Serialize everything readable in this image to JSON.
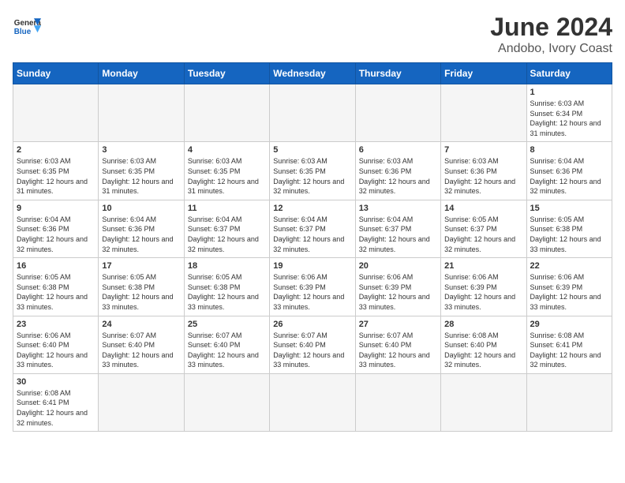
{
  "header": {
    "logo_general": "General",
    "logo_blue": "Blue",
    "title": "June 2024",
    "subtitle": "Andobo, Ivory Coast"
  },
  "weekdays": [
    "Sunday",
    "Monday",
    "Tuesday",
    "Wednesday",
    "Thursday",
    "Friday",
    "Saturday"
  ],
  "weeks": [
    [
      {
        "day": "",
        "info": ""
      },
      {
        "day": "",
        "info": ""
      },
      {
        "day": "",
        "info": ""
      },
      {
        "day": "",
        "info": ""
      },
      {
        "day": "",
        "info": ""
      },
      {
        "day": "",
        "info": ""
      },
      {
        "day": "1",
        "info": "Sunrise: 6:03 AM\nSunset: 6:34 PM\nDaylight: 12 hours and 31 minutes."
      }
    ],
    [
      {
        "day": "2",
        "info": "Sunrise: 6:03 AM\nSunset: 6:35 PM\nDaylight: 12 hours and 31 minutes."
      },
      {
        "day": "3",
        "info": "Sunrise: 6:03 AM\nSunset: 6:35 PM\nDaylight: 12 hours and 31 minutes."
      },
      {
        "day": "4",
        "info": "Sunrise: 6:03 AM\nSunset: 6:35 PM\nDaylight: 12 hours and 31 minutes."
      },
      {
        "day": "5",
        "info": "Sunrise: 6:03 AM\nSunset: 6:35 PM\nDaylight: 12 hours and 32 minutes."
      },
      {
        "day": "6",
        "info": "Sunrise: 6:03 AM\nSunset: 6:36 PM\nDaylight: 12 hours and 32 minutes."
      },
      {
        "day": "7",
        "info": "Sunrise: 6:03 AM\nSunset: 6:36 PM\nDaylight: 12 hours and 32 minutes."
      },
      {
        "day": "8",
        "info": "Sunrise: 6:04 AM\nSunset: 6:36 PM\nDaylight: 12 hours and 32 minutes."
      }
    ],
    [
      {
        "day": "9",
        "info": "Sunrise: 6:04 AM\nSunset: 6:36 PM\nDaylight: 12 hours and 32 minutes."
      },
      {
        "day": "10",
        "info": "Sunrise: 6:04 AM\nSunset: 6:36 PM\nDaylight: 12 hours and 32 minutes."
      },
      {
        "day": "11",
        "info": "Sunrise: 6:04 AM\nSunset: 6:37 PM\nDaylight: 12 hours and 32 minutes."
      },
      {
        "day": "12",
        "info": "Sunrise: 6:04 AM\nSunset: 6:37 PM\nDaylight: 12 hours and 32 minutes."
      },
      {
        "day": "13",
        "info": "Sunrise: 6:04 AM\nSunset: 6:37 PM\nDaylight: 12 hours and 32 minutes."
      },
      {
        "day": "14",
        "info": "Sunrise: 6:05 AM\nSunset: 6:37 PM\nDaylight: 12 hours and 32 minutes."
      },
      {
        "day": "15",
        "info": "Sunrise: 6:05 AM\nSunset: 6:38 PM\nDaylight: 12 hours and 33 minutes."
      }
    ],
    [
      {
        "day": "16",
        "info": "Sunrise: 6:05 AM\nSunset: 6:38 PM\nDaylight: 12 hours and 33 minutes."
      },
      {
        "day": "17",
        "info": "Sunrise: 6:05 AM\nSunset: 6:38 PM\nDaylight: 12 hours and 33 minutes."
      },
      {
        "day": "18",
        "info": "Sunrise: 6:05 AM\nSunset: 6:38 PM\nDaylight: 12 hours and 33 minutes."
      },
      {
        "day": "19",
        "info": "Sunrise: 6:06 AM\nSunset: 6:39 PM\nDaylight: 12 hours and 33 minutes."
      },
      {
        "day": "20",
        "info": "Sunrise: 6:06 AM\nSunset: 6:39 PM\nDaylight: 12 hours and 33 minutes."
      },
      {
        "day": "21",
        "info": "Sunrise: 6:06 AM\nSunset: 6:39 PM\nDaylight: 12 hours and 33 minutes."
      },
      {
        "day": "22",
        "info": "Sunrise: 6:06 AM\nSunset: 6:39 PM\nDaylight: 12 hours and 33 minutes."
      }
    ],
    [
      {
        "day": "23",
        "info": "Sunrise: 6:06 AM\nSunset: 6:40 PM\nDaylight: 12 hours and 33 minutes."
      },
      {
        "day": "24",
        "info": "Sunrise: 6:07 AM\nSunset: 6:40 PM\nDaylight: 12 hours and 33 minutes."
      },
      {
        "day": "25",
        "info": "Sunrise: 6:07 AM\nSunset: 6:40 PM\nDaylight: 12 hours and 33 minutes."
      },
      {
        "day": "26",
        "info": "Sunrise: 6:07 AM\nSunset: 6:40 PM\nDaylight: 12 hours and 33 minutes."
      },
      {
        "day": "27",
        "info": "Sunrise: 6:07 AM\nSunset: 6:40 PM\nDaylight: 12 hours and 33 minutes."
      },
      {
        "day": "28",
        "info": "Sunrise: 6:08 AM\nSunset: 6:40 PM\nDaylight: 12 hours and 32 minutes."
      },
      {
        "day": "29",
        "info": "Sunrise: 6:08 AM\nSunset: 6:41 PM\nDaylight: 12 hours and 32 minutes."
      }
    ],
    [
      {
        "day": "30",
        "info": "Sunrise: 6:08 AM\nSunset: 6:41 PM\nDaylight: 12 hours and 32 minutes."
      },
      {
        "day": "",
        "info": ""
      },
      {
        "day": "",
        "info": ""
      },
      {
        "day": "",
        "info": ""
      },
      {
        "day": "",
        "info": ""
      },
      {
        "day": "",
        "info": ""
      },
      {
        "day": "",
        "info": ""
      }
    ]
  ]
}
